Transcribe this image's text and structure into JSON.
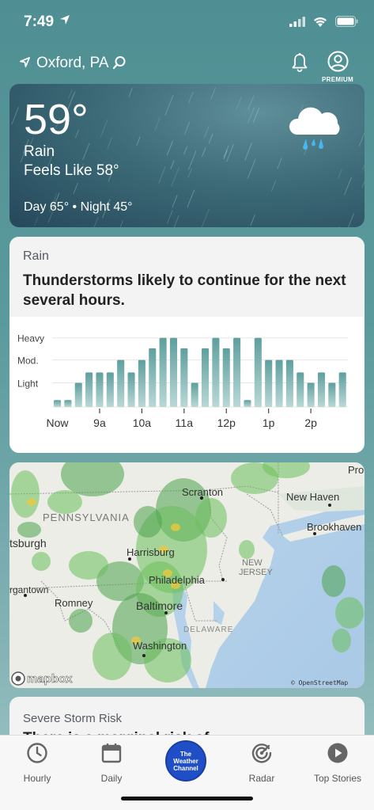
{
  "status_bar": {
    "time": "7:49"
  },
  "header": {
    "location": "Oxford, PA",
    "premium_label": "PREMIUM"
  },
  "current": {
    "temperature": "59°",
    "condition": "Rain",
    "feels_like": "Feels Like 58°",
    "day_night": "Day 65° • Night 45°"
  },
  "rain_card": {
    "label": "Rain",
    "headline": "Thunderstorms likely to continue for the next several hours."
  },
  "chart_data": {
    "type": "bar",
    "y_levels": [
      "Heavy",
      "Mod.",
      "Light"
    ],
    "x_tick_labels": [
      "Now",
      "9a",
      "10a",
      "11a",
      "12p",
      "1p",
      "2p"
    ],
    "values": [
      0.1,
      0.1,
      0.35,
      0.5,
      0.5,
      0.5,
      0.68,
      0.5,
      0.68,
      0.85,
      1.0,
      1.0,
      0.85,
      0.35,
      0.85,
      1.0,
      0.85,
      1.0,
      0.1,
      1.0,
      0.68,
      0.68,
      0.68,
      0.5,
      0.35,
      0.5,
      0.35,
      0.5
    ],
    "ylim": [
      0,
      1.1
    ],
    "grid": true,
    "colors": {
      "bar_top": "#5e9f9d",
      "bar_bottom": "#b9d8d6"
    }
  },
  "map": {
    "places": [
      "Pro",
      "Scranton",
      "New Haven",
      "PENNSYLVANIA",
      "Brookhaven",
      "tsburgh",
      "Harrisburg",
      "NEW",
      "JERSEY",
      "Philadelphia",
      "rgantown",
      "Romney",
      "Baltimore",
      "DELAWARE",
      "Washington"
    ],
    "attribution_logo": "mapbox",
    "attribution_text": "© OpenStreetMap"
  },
  "severe_card": {
    "label": "Severe Storm Risk",
    "headline": "There is a marginal risk of"
  },
  "tabbar": {
    "tabs": [
      {
        "label": "Hourly",
        "icon": "clock-icon"
      },
      {
        "label": "Daily",
        "icon": "calendar-icon"
      },
      {
        "label": "The Weather Channel",
        "icon": "twc-logo"
      },
      {
        "label": "Radar",
        "icon": "radar-icon"
      },
      {
        "label": "Top Stories",
        "icon": "play-icon"
      }
    ],
    "logo_lines": [
      "The",
      "Weather",
      "Channel"
    ]
  },
  "colors": {
    "twc_blue": "#1f4ec7",
    "accent": "#5e9f9d"
  }
}
